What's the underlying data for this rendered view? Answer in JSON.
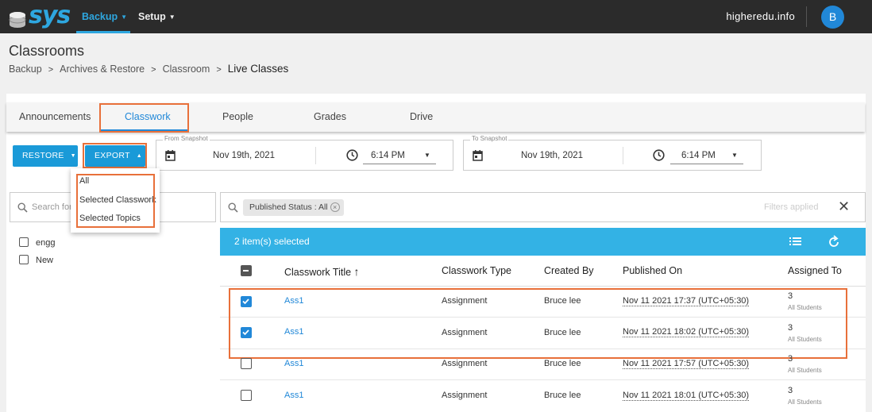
{
  "colors": {
    "brand": "#2ea7e0",
    "accent": "#2188d8",
    "highlight": "#e8703a",
    "topbar": "#2b2b2b"
  },
  "nav": {
    "logo_text": "sys",
    "backup": "Backup",
    "setup": "Setup",
    "domain": "higheredu.info",
    "avatar_initial": "B"
  },
  "page": {
    "title": "Classrooms",
    "breadcrumb": [
      "Backup",
      "Archives & Restore",
      "Classroom",
      "Live Classes"
    ]
  },
  "tabs": [
    "Announcements",
    "Classwork",
    "People",
    "Grades",
    "Drive"
  ],
  "active_tab": "Classwork",
  "toolbar": {
    "restore": "RESTORE",
    "export": "EXPORT",
    "from_legend": "From Snapshot",
    "from_date": "Nov 19th, 2021",
    "from_time": "6:14 PM",
    "to_legend": "To Snapshot",
    "to_date": "Nov 19th, 2021",
    "to_time": "6:14 PM"
  },
  "export_menu": [
    "All",
    "Selected Classwork",
    "Selected Topics"
  ],
  "left_panel": {
    "search_placeholder": "Search for",
    "items": [
      "engg",
      "New"
    ]
  },
  "filters": {
    "chip": "Published Status : All",
    "applied_text": "Filters applied"
  },
  "table": {
    "selected_text": "2 item(s) selected",
    "columns": [
      "Classwork Title",
      "Classwork Type",
      "Created By",
      "Published On",
      "Assigned To"
    ],
    "assigned_sub": "All Students",
    "rows": [
      {
        "title": "Ass1",
        "type": "Assignment",
        "created_by": "Bruce lee",
        "published_on": "Nov 11 2021 17:37 (UTC+05:30)",
        "assigned": "3",
        "checked": true
      },
      {
        "title": "Ass1",
        "type": "Assignment",
        "created_by": "Bruce lee",
        "published_on": "Nov 11 2021 18:02 (UTC+05:30)",
        "assigned": "3",
        "checked": true
      },
      {
        "title": "Ass1",
        "type": "Assignment",
        "created_by": "Bruce lee",
        "published_on": "Nov 11 2021 17:57 (UTC+05:30)",
        "assigned": "3",
        "checked": false
      },
      {
        "title": "Ass1",
        "type": "Assignment",
        "created_by": "Bruce lee",
        "published_on": "Nov 11 2021 18:01 (UTC+05:30)",
        "assigned": "3",
        "checked": false
      }
    ]
  }
}
